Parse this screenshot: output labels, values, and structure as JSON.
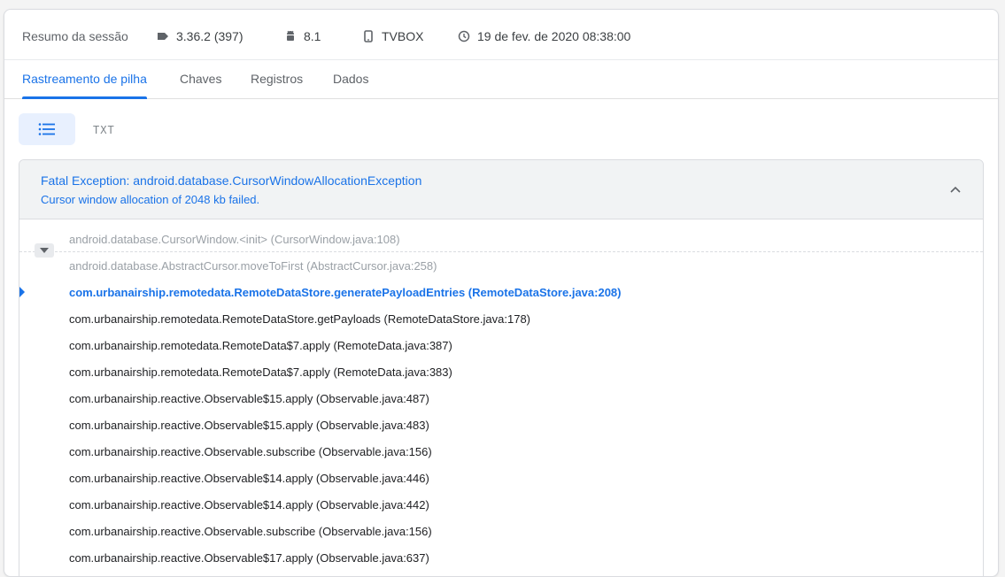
{
  "summary": {
    "title": "Resumo da sessão",
    "version": "3.36.2 (397)",
    "os_version": "8.1",
    "device": "TVBOX",
    "timestamp": "19 de fev. de 2020 08:38:00"
  },
  "tabs": [
    {
      "label": "Rastreamento de pilha",
      "active": true
    },
    {
      "label": "Chaves",
      "active": false
    },
    {
      "label": "Registros",
      "active": false
    },
    {
      "label": "Dados",
      "active": false
    }
  ],
  "view": {
    "list_icon": "list-icon",
    "txt_label": "TXT"
  },
  "exception": {
    "title": "Fatal Exception: android.database.CursorWindowAllocationException",
    "message": "Cursor window allocation of 2048 kb failed."
  },
  "frames": [
    "android.database.CursorWindow.<init> (CursorWindow.java:108)",
    "android.database.AbstractCursor.moveToFirst (AbstractCursor.java:258)",
    "com.urbanairship.remotedata.RemoteDataStore.generatePayloadEntries (RemoteDataStore.java:208)",
    "com.urbanairship.remotedata.RemoteDataStore.getPayloads (RemoteDataStore.java:178)",
    "com.urbanairship.remotedata.RemoteData$7.apply (RemoteData.java:387)",
    "com.urbanairship.remotedata.RemoteData$7.apply (RemoteData.java:383)",
    "com.urbanairship.reactive.Observable$15.apply (Observable.java:487)",
    "com.urbanairship.reactive.Observable$15.apply (Observable.java:483)",
    "com.urbanairship.reactive.Observable.subscribe (Observable.java:156)",
    "com.urbanairship.reactive.Observable$14.apply (Observable.java:446)",
    "com.urbanairship.reactive.Observable$14.apply (Observable.java:442)",
    "com.urbanairship.reactive.Observable.subscribe (Observable.java:156)",
    "com.urbanairship.reactive.Observable$17.apply (Observable.java:637)"
  ],
  "colors": {
    "accent": "#1a73e8",
    "muted": "#9aa0a6",
    "text": "#202124"
  }
}
